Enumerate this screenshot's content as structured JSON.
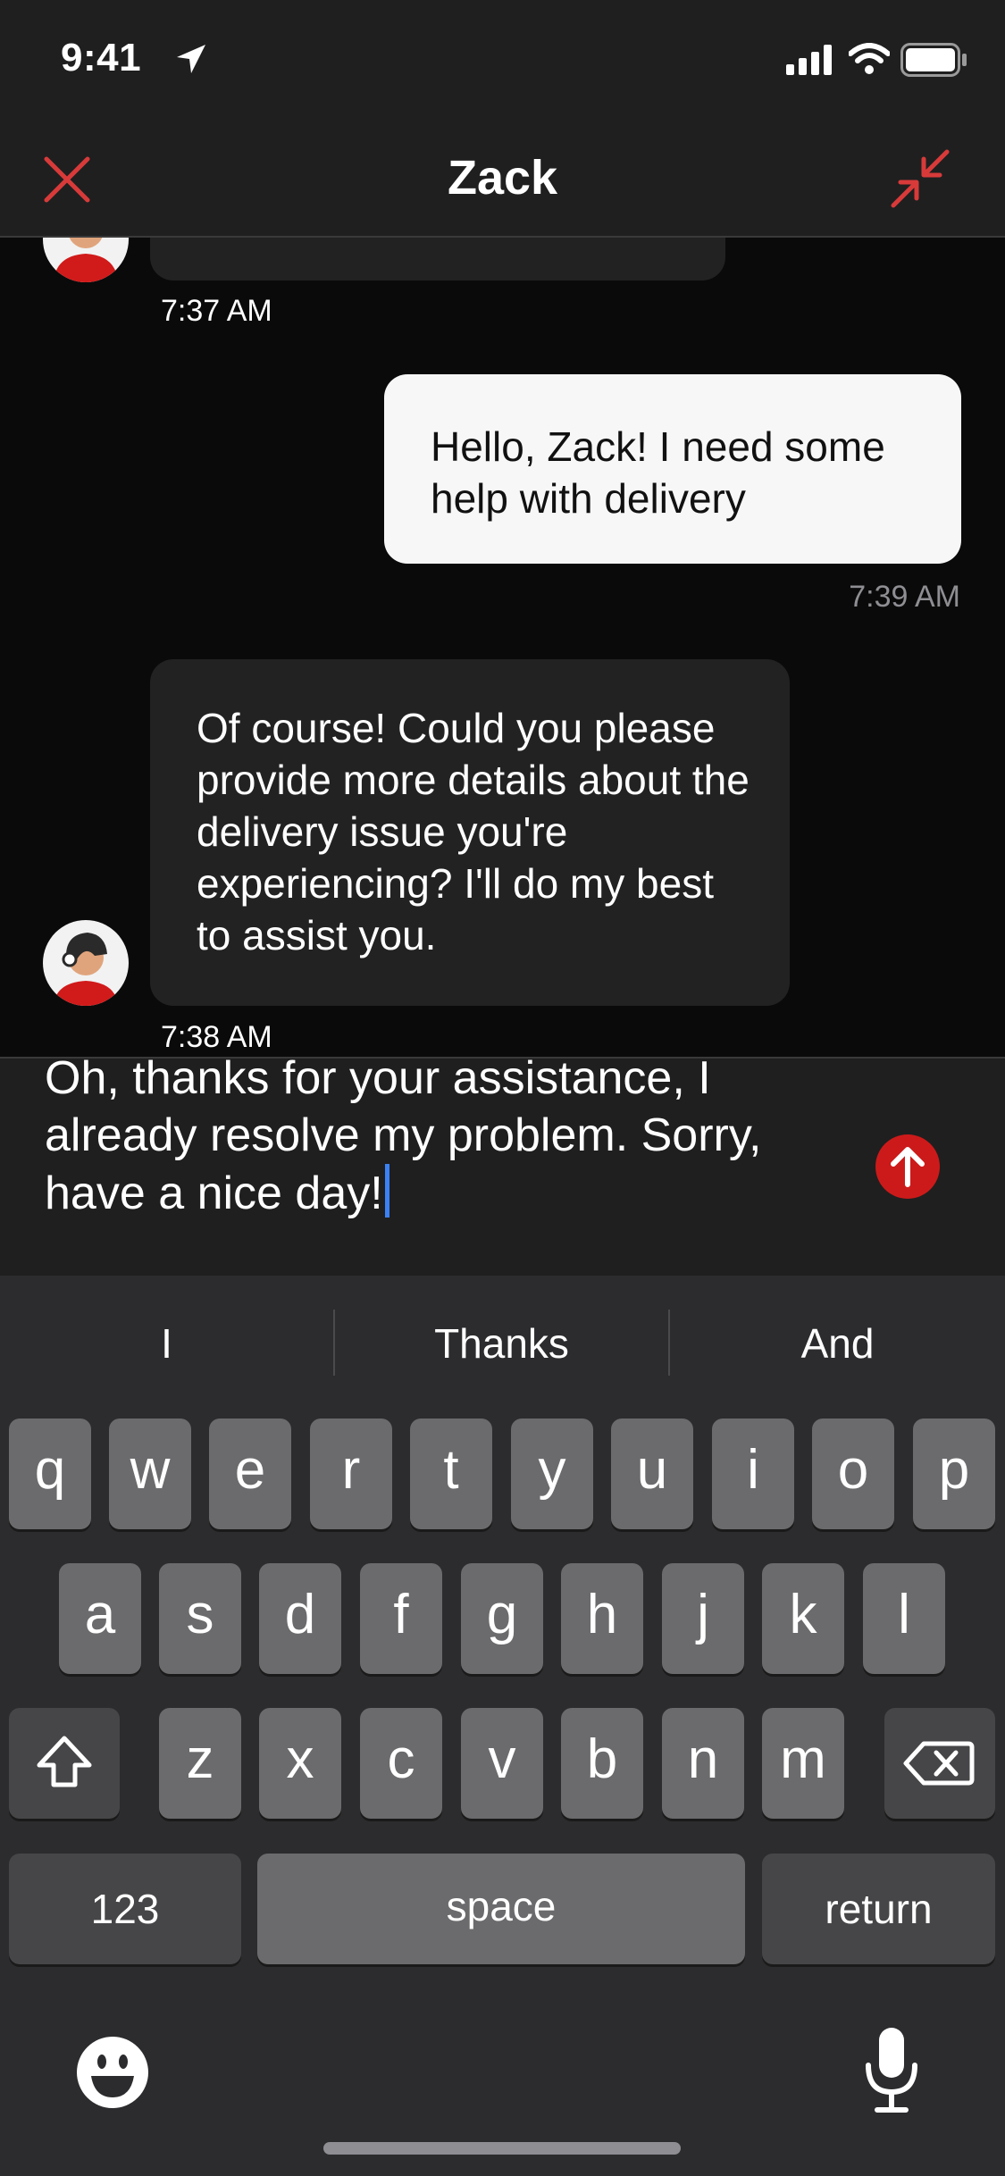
{
  "status_bar": {
    "time": "9:41"
  },
  "header": {
    "title": "Zack",
    "close_icon": "close-icon",
    "minimize_icon": "minimize-icon"
  },
  "messages": [
    {
      "from": "agent",
      "timestamp": "7:37 AM"
    },
    {
      "from": "user",
      "text": "Hello, Zack! I need some help with delivery",
      "timestamp": "7:39 AM"
    },
    {
      "from": "agent",
      "text": "Of course! Could you please provide more details about the delivery issue you're experiencing? I'll do my best to assist you.",
      "timestamp": "7:38 AM"
    }
  ],
  "composer": {
    "value": "Oh, thanks for your assistance, I already resolve my problem. Sorry, have a nice day!",
    "send_icon": "send-arrow-up-icon"
  },
  "keyboard": {
    "suggestions": [
      "I",
      "Thanks",
      "And"
    ],
    "row1": [
      "q",
      "w",
      "e",
      "r",
      "t",
      "y",
      "u",
      "i",
      "o",
      "p"
    ],
    "row2": [
      "a",
      "s",
      "d",
      "f",
      "g",
      "h",
      "j",
      "k",
      "l"
    ],
    "row3": [
      "z",
      "x",
      "c",
      "v",
      "b",
      "n",
      "m"
    ],
    "numbers_label": "123",
    "space_label": "space",
    "return_label": "return"
  },
  "colors": {
    "accent": "#cc1a1a",
    "caret": "#3b82f6"
  }
}
